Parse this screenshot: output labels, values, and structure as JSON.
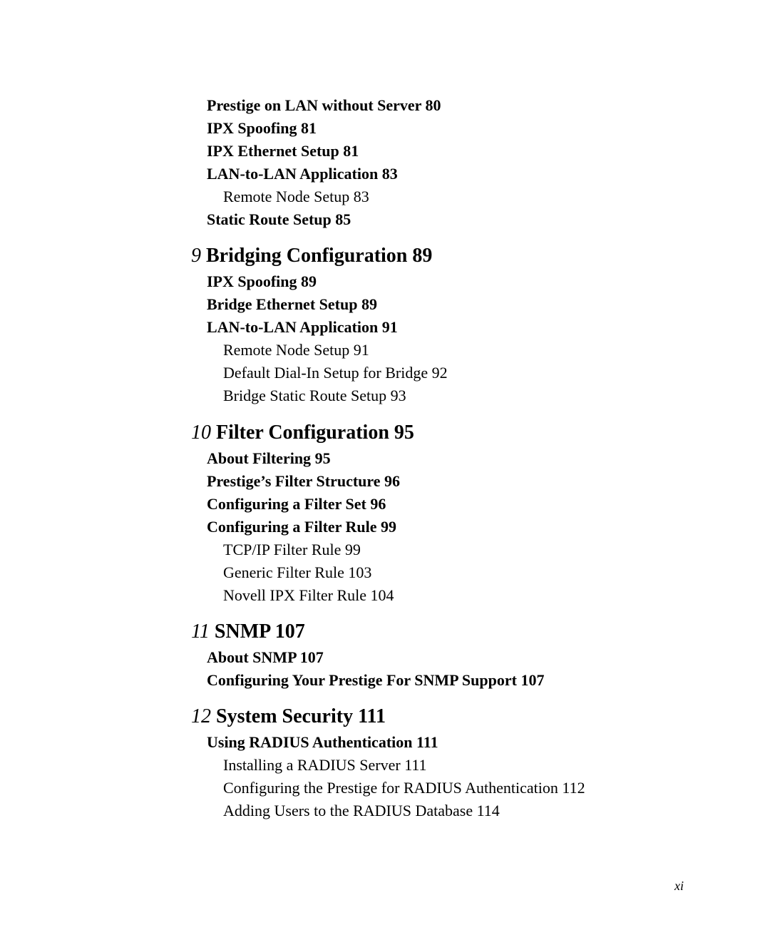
{
  "toc": {
    "continued_entries": [
      {
        "level": 2,
        "title": "Prestige on LAN without Server",
        "page": "80"
      },
      {
        "level": 2,
        "title": "IPX Spoofing",
        "page": "81"
      },
      {
        "level": 2,
        "title": "IPX Ethernet Setup",
        "page": "81"
      },
      {
        "level": 2,
        "title": "LAN-to-LAN Application",
        "page": "83"
      },
      {
        "level": 3,
        "title": "Remote Node Setup",
        "page": "83"
      },
      {
        "level": 2,
        "title": "Static Route Setup",
        "page": "85"
      }
    ],
    "chapters": [
      {
        "number": "9",
        "title": "Bridging Configuration",
        "page": "89",
        "entries": [
          {
            "level": 2,
            "title": "IPX Spoofing",
            "page": "89"
          },
          {
            "level": 2,
            "title": "Bridge Ethernet Setup",
            "page": "89"
          },
          {
            "level": 2,
            "title": "LAN-to-LAN Application",
            "page": "91"
          },
          {
            "level": 3,
            "title": "Remote Node Setup",
            "page": "91"
          },
          {
            "level": 3,
            "title": "Default Dial-In Setup for Bridge",
            "page": "92"
          },
          {
            "level": 3,
            "title": "Bridge Static Route Setup",
            "page": "93"
          }
        ]
      },
      {
        "number": "10",
        "title": "Filter Configuration",
        "page": "95",
        "entries": [
          {
            "level": 2,
            "title": "About Filtering",
            "page": "95"
          },
          {
            "level": 2,
            "title": "Prestige’s Filter Structure",
            "page": "96"
          },
          {
            "level": 2,
            "title": "Configuring a Filter Set",
            "page": "96"
          },
          {
            "level": 2,
            "title": "Configuring a Filter Rule",
            "page": "99"
          },
          {
            "level": 3,
            "title": "TCP/IP Filter Rule",
            "page": "99"
          },
          {
            "level": 3,
            "title": "Generic Filter Rule",
            "page": "103"
          },
          {
            "level": 3,
            "title": "Novell IPX Filter Rule",
            "page": "104"
          }
        ]
      },
      {
        "number": "11",
        "title": "SNMP",
        "page": "107",
        "entries": [
          {
            "level": 2,
            "title": "About SNMP",
            "page": "107"
          },
          {
            "level": 2,
            "title": "Configuring Your Prestige For SNMP Support",
            "page": "107"
          }
        ]
      },
      {
        "number": "12",
        "title": "System Security",
        "page": "111",
        "entries": [
          {
            "level": 2,
            "title": "Using RADIUS Authentication",
            "page": "111"
          },
          {
            "level": 3,
            "title": "Installing a RADIUS Server",
            "page": "111"
          },
          {
            "level": 3,
            "title": "Configuring the Prestige for RADIUS Authentication",
            "page": "112"
          },
          {
            "level": 3,
            "title": "Adding Users to the RADIUS Database",
            "page": "114"
          }
        ]
      }
    ]
  },
  "footer": {
    "page_number": "xi"
  }
}
